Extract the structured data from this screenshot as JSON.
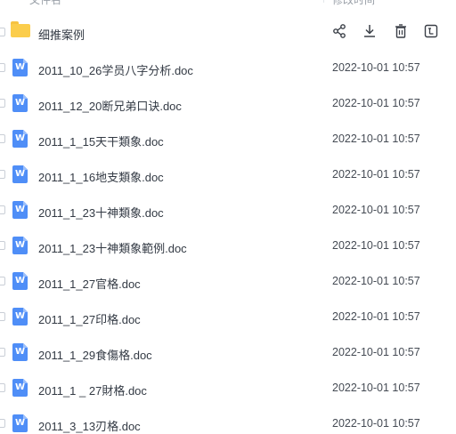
{
  "header": {
    "col_name": "文件名",
    "col_time": "修改时间"
  },
  "folder": {
    "name": "细推案例",
    "actions": [
      {
        "name": "share-icon"
      },
      {
        "name": "download-icon"
      },
      {
        "name": "delete-icon"
      },
      {
        "name": "more-icon"
      }
    ]
  },
  "files": [
    {
      "name": "2011_10_26学员八字分析.doc",
      "time": "2022-10-01 10:57"
    },
    {
      "name": "2011_12_20断兄弟口诀.doc",
      "time": "2022-10-01 10:57"
    },
    {
      "name": "2011_1_15天干類象.doc",
      "time": "2022-10-01 10:57"
    },
    {
      "name": "2011_1_16地支類象.doc",
      "time": "2022-10-01 10:57"
    },
    {
      "name": "2011_1_23十神類象.doc",
      "time": "2022-10-01 10:57"
    },
    {
      "name": "2011_1_23十神類象範例.doc",
      "time": "2022-10-01 10:57"
    },
    {
      "name": "2011_1_27官格.doc",
      "time": "2022-10-01 10:57"
    },
    {
      "name": "2011_1_27印格.doc",
      "time": "2022-10-01 10:57"
    },
    {
      "name": "2011_1_29食傷格.doc",
      "time": "2022-10-01 10:57"
    },
    {
      "name": "2011_1 _ 27財格.doc",
      "time": "2022-10-01 10:57"
    },
    {
      "name": "2011_3_13刃格.doc",
      "time": "2022-10-01 10:57"
    }
  ],
  "colors": {
    "doc_icon": "#4f8ef7",
    "folder_icon": "#fbcd4c",
    "sort_arrow": "#4a8cf7"
  }
}
